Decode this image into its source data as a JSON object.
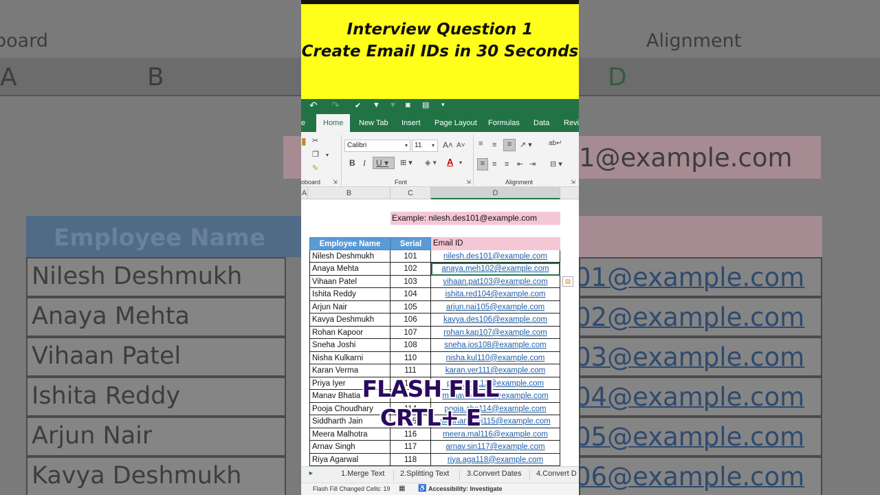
{
  "banner": {
    "line1": "Interview Question 1",
    "line2": "Create Email IDs in 30 Seconds"
  },
  "ribbon": {
    "tabs": [
      "e",
      "Home",
      "New Tab",
      "Insert",
      "Page Layout",
      "Formulas",
      "Data",
      "Revi"
    ],
    "font_name": "Calibri",
    "font_size": "11",
    "groups": {
      "clipboard": "oboard",
      "font": "Font",
      "alignment": "Alignment"
    }
  },
  "columns": [
    "A",
    "B",
    "C",
    "D"
  ],
  "example": "Example:  nilesh.des101@example.com",
  "table": {
    "headers": [
      "Employee Name",
      "Serial",
      "Email ID"
    ],
    "rows": [
      [
        "Nilesh Deshmukh",
        "101",
        "nilesh.des101@example.com"
      ],
      [
        "Anaya Mehta",
        "102",
        "anaya.meh102@example.com"
      ],
      [
        "Vihaan Patel",
        "103",
        "vihaan.pat103@example.com"
      ],
      [
        "Ishita Reddy",
        "104",
        "ishita.red104@example.com"
      ],
      [
        "Arjun Nair",
        "105",
        "arjun.nai105@example.com"
      ],
      [
        "Kavya Deshmukh",
        "106",
        "kavya.des106@example.com"
      ],
      [
        "Rohan Kapoor",
        "107",
        "rohan.kap107@example.com"
      ],
      [
        "Sneha Joshi",
        "108",
        "sneha.jos108@example.com"
      ],
      [
        "Nisha Kulkarni",
        "110",
        "nisha.kul110@example.com"
      ],
      [
        "Karan Verma",
        "111",
        "karan.ver111@example.com"
      ],
      [
        "Priya Iyer",
        "112",
        "priya.iye112@example.com"
      ],
      [
        "Manav Bhatia",
        "113",
        "manav.bha113@example.com"
      ],
      [
        "Pooja Choudhary",
        "114",
        "pooja.cho114@example.com"
      ],
      [
        "Siddharth Jain",
        "115",
        "siddharth.jai115@example.com"
      ],
      [
        "Meera Malhotra",
        "116",
        "meera.mal116@example.com"
      ],
      [
        "Arnav Singh",
        "117",
        "arnav.sin117@example.com"
      ],
      [
        "Riya Agarwal",
        "118",
        "riya.aga118@example.com"
      ]
    ]
  },
  "overlay": {
    "line1": "FLASH FILL",
    "line2": "CRTL+ E"
  },
  "sheet_tabs": [
    "1.Merge Text",
    "2.Splitting Text",
    "3.Convert Dates",
    "4.Convert D"
  ],
  "status": {
    "message": "Flash Fill Changed Cells: 19",
    "accessibility": "Accessibility: Investigate"
  },
  "background": {
    "clipboard": "board",
    "alignment": "Alignment",
    "colA": "A",
    "colB": "B",
    "colD": "D",
    "example_tail": "1@example.com",
    "header": "Employee Name",
    "names": [
      "Nilesh Deshmukh",
      "Anaya Mehta",
      "Vihaan Patel",
      "Ishita Reddy",
      "Arjun Nair",
      "Kavya Deshmukh"
    ],
    "emails": [
      "01@example.com",
      "02@example.com",
      "03@example.com",
      "04@example.com",
      "05@example.com",
      "06@example.com"
    ]
  },
  "colors": {
    "excel_green": "#217346",
    "banner_yellow": "#ffff1a",
    "header_blue": "#5b9bd5",
    "pink": "#f4c7d4",
    "link": "#1f5fa8",
    "overlay": "#2b0a5e"
  }
}
